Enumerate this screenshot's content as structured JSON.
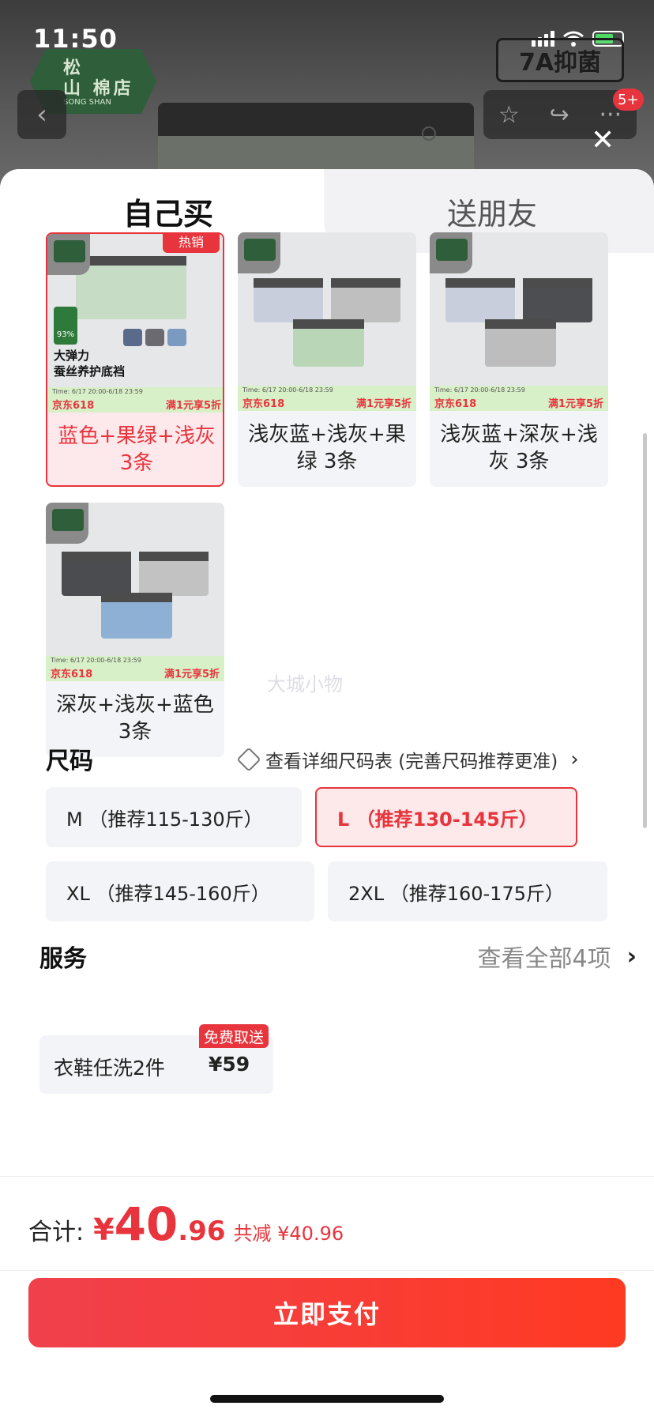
{
  "status_bar": {
    "time": "11:50"
  },
  "header": {
    "shop_badge": {
      "line1": "松",
      "line2": "山  棉店",
      "line3": "SONG SHAN"
    },
    "product_tag": "7A抑菌",
    "message_count": "5+"
  },
  "tabs": [
    {
      "label": "自己买"
    },
    {
      "label": "送朋友"
    }
  ],
  "options": [
    {
      "label": "蓝色+果绿+浅灰3条",
      "selected": true,
      "hot_tag": "热销",
      "promo_left": "京东618",
      "promo_right": "满1元享5折",
      "promo_tiny": "Time: 6/17 20:00-6/18 23:59",
      "image_text": "大弹力\n蚕丝养护底裆",
      "leaf_text": "93%"
    },
    {
      "label": "浅灰蓝+浅灰+果绿 3条",
      "selected": false,
      "promo_left": "京东618",
      "promo_right": "满1元享5折",
      "promo_tiny": "Time: 6/17 20:00-6/18 23:59"
    },
    {
      "label": "浅灰蓝+深灰+浅灰 3条",
      "selected": false,
      "promo_left": "京东618",
      "promo_right": "满1元享5折",
      "promo_tiny": "Time: 6/17 20:00-6/18 23:59"
    },
    {
      "label": "深灰+浅灰+蓝色3条",
      "selected": false,
      "promo_left": "京东618",
      "promo_right": "满1元享5折",
      "promo_tiny": "Time: 6/17 20:00-6/18 23:59"
    }
  ],
  "watermark": "大城小物",
  "size_section": {
    "title": "尺码",
    "chart_link": "查看详细尺码表 (完善尺码推荐更准)",
    "sizes": [
      {
        "label": "M （推荐115-130斤）",
        "selected": false
      },
      {
        "label": "L （推荐130-145斤）",
        "selected": true
      },
      {
        "label": "XL （推荐145-160斤）",
        "selected": false
      },
      {
        "label": "2XL （推荐160-175斤）",
        "selected": false
      }
    ]
  },
  "service_section": {
    "title": "服务",
    "view_all": "查看全部4项",
    "items": [
      {
        "name": "衣鞋任洗2件",
        "price": "¥59",
        "badge": "免费取送"
      }
    ]
  },
  "footer": {
    "total_label": "合计:",
    "currency": "¥",
    "price_int": "40",
    "price_dec": ".96",
    "saved": "共减 ¥40.96",
    "pay_button": "立即支付"
  },
  "colors": {
    "accent": "#e8353d",
    "promo_green": "#d8f0c8",
    "brand_green": "#2e5e3a"
  }
}
